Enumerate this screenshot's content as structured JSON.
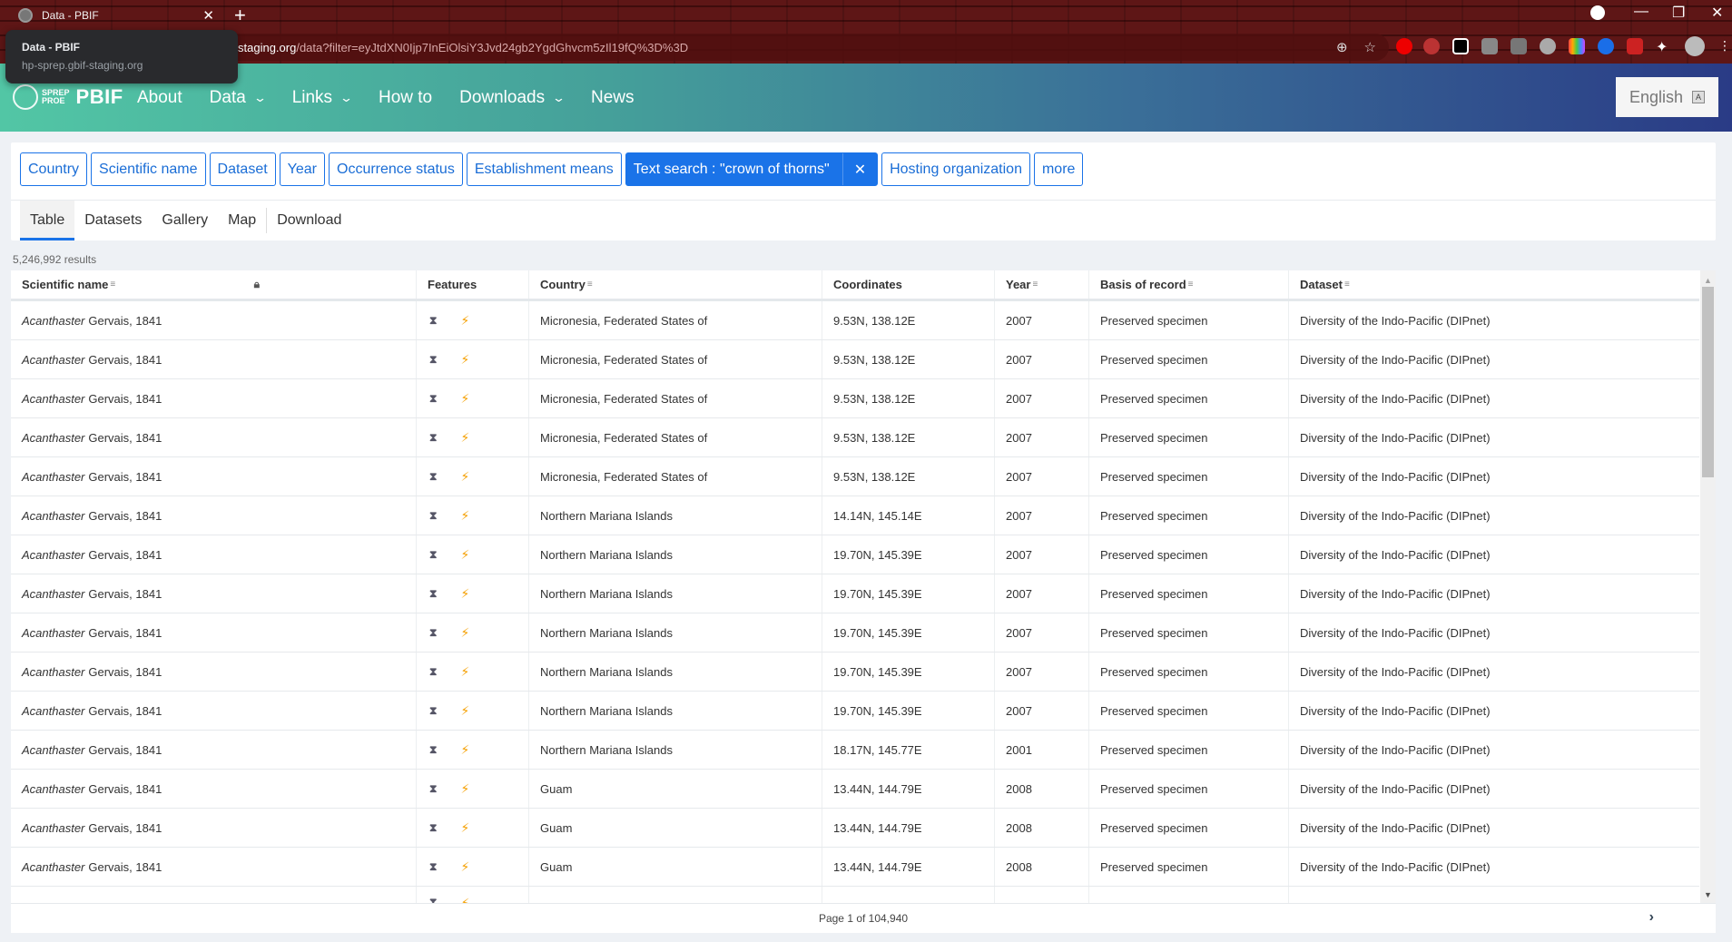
{
  "browser": {
    "tab_title": "Data - PBIF",
    "tooltip_title": "Data - PBIF",
    "tooltip_host": "hp-sprep.gbif-staging.org",
    "url_host": "staging.org",
    "url_rest": "/data?filter=eyJtdXN0Ijp7InEiOlsiY3Jvd24gb2YgdGhvcm5zIl19fQ%3D%3D"
  },
  "header": {
    "logo_text_1": "SPREP",
    "logo_text_2": "PROE",
    "logo_brand": "PBIF",
    "nav": [
      {
        "label": "About",
        "dropdown": false
      },
      {
        "label": "Data",
        "dropdown": true
      },
      {
        "label": "Links",
        "dropdown": true
      },
      {
        "label": "How to",
        "dropdown": false
      },
      {
        "label": "Downloads",
        "dropdown": true
      },
      {
        "label": "News",
        "dropdown": false
      }
    ],
    "language": "English"
  },
  "filters": [
    {
      "label": "Country"
    },
    {
      "label": "Scientific name"
    },
    {
      "label": "Dataset"
    },
    {
      "label": "Year"
    },
    {
      "label": "Occurrence status"
    },
    {
      "label": "Establishment means"
    },
    {
      "label": "Text search : \"crown of thorns\"",
      "active": true
    },
    {
      "label": "Hosting organization"
    },
    {
      "label": "more"
    }
  ],
  "view_tabs": [
    {
      "label": "Table",
      "active": true
    },
    {
      "label": "Datasets"
    },
    {
      "label": "Gallery"
    },
    {
      "label": "Map"
    },
    {
      "label": "Download"
    }
  ],
  "results_count": "5,246,992 results",
  "table": {
    "columns": [
      "Scientific name",
      "Features",
      "Country",
      "Coordinates",
      "Year",
      "Basis of record",
      "Dataset"
    ],
    "rows": [
      {
        "genus": "Acanthaster",
        "author": "Gervais, 1841",
        "country": "Micronesia, Federated States of",
        "coords": "9.53N, 138.12E",
        "year": "2007",
        "basis": "Preserved specimen",
        "dataset": "Diversity of the Indo-Pacific (DIPnet)"
      },
      {
        "genus": "Acanthaster",
        "author": "Gervais, 1841",
        "country": "Micronesia, Federated States of",
        "coords": "9.53N, 138.12E",
        "year": "2007",
        "basis": "Preserved specimen",
        "dataset": "Diversity of the Indo-Pacific (DIPnet)"
      },
      {
        "genus": "Acanthaster",
        "author": "Gervais, 1841",
        "country": "Micronesia, Federated States of",
        "coords": "9.53N, 138.12E",
        "year": "2007",
        "basis": "Preserved specimen",
        "dataset": "Diversity of the Indo-Pacific (DIPnet)"
      },
      {
        "genus": "Acanthaster",
        "author": "Gervais, 1841",
        "country": "Micronesia, Federated States of",
        "coords": "9.53N, 138.12E",
        "year": "2007",
        "basis": "Preserved specimen",
        "dataset": "Diversity of the Indo-Pacific (DIPnet)"
      },
      {
        "genus": "Acanthaster",
        "author": "Gervais, 1841",
        "country": "Micronesia, Federated States of",
        "coords": "9.53N, 138.12E",
        "year": "2007",
        "basis": "Preserved specimen",
        "dataset": "Diversity of the Indo-Pacific (DIPnet)"
      },
      {
        "genus": "Acanthaster",
        "author": "Gervais, 1841",
        "country": "Northern Mariana Islands",
        "coords": "14.14N, 145.14E",
        "year": "2007",
        "basis": "Preserved specimen",
        "dataset": "Diversity of the Indo-Pacific (DIPnet)"
      },
      {
        "genus": "Acanthaster",
        "author": "Gervais, 1841",
        "country": "Northern Mariana Islands",
        "coords": "19.70N, 145.39E",
        "year": "2007",
        "basis": "Preserved specimen",
        "dataset": "Diversity of the Indo-Pacific (DIPnet)"
      },
      {
        "genus": "Acanthaster",
        "author": "Gervais, 1841",
        "country": "Northern Mariana Islands",
        "coords": "19.70N, 145.39E",
        "year": "2007",
        "basis": "Preserved specimen",
        "dataset": "Diversity of the Indo-Pacific (DIPnet)"
      },
      {
        "genus": "Acanthaster",
        "author": "Gervais, 1841",
        "country": "Northern Mariana Islands",
        "coords": "19.70N, 145.39E",
        "year": "2007",
        "basis": "Preserved specimen",
        "dataset": "Diversity of the Indo-Pacific (DIPnet)"
      },
      {
        "genus": "Acanthaster",
        "author": "Gervais, 1841",
        "country": "Northern Mariana Islands",
        "coords": "19.70N, 145.39E",
        "year": "2007",
        "basis": "Preserved specimen",
        "dataset": "Diversity of the Indo-Pacific (DIPnet)"
      },
      {
        "genus": "Acanthaster",
        "author": "Gervais, 1841",
        "country": "Northern Mariana Islands",
        "coords": "19.70N, 145.39E",
        "year": "2007",
        "basis": "Preserved specimen",
        "dataset": "Diversity of the Indo-Pacific (DIPnet)"
      },
      {
        "genus": "Acanthaster",
        "author": "Gervais, 1841",
        "country": "Northern Mariana Islands",
        "coords": "18.17N, 145.77E",
        "year": "2001",
        "basis": "Preserved specimen",
        "dataset": "Diversity of the Indo-Pacific (DIPnet)"
      },
      {
        "genus": "Acanthaster",
        "author": "Gervais, 1841",
        "country": "Guam",
        "coords": "13.44N, 144.79E",
        "year": "2008",
        "basis": "Preserved specimen",
        "dataset": "Diversity of the Indo-Pacific (DIPnet)"
      },
      {
        "genus": "Acanthaster",
        "author": "Gervais, 1841",
        "country": "Guam",
        "coords": "13.44N, 144.79E",
        "year": "2008",
        "basis": "Preserved specimen",
        "dataset": "Diversity of the Indo-Pacific (DIPnet)"
      },
      {
        "genus": "Acanthaster",
        "author": "Gervais, 1841",
        "country": "Guam",
        "coords": "13.44N, 144.79E",
        "year": "2008",
        "basis": "Preserved specimen",
        "dataset": "Diversity of the Indo-Pacific (DIPnet)"
      },
      {
        "genus": "",
        "author": "",
        "country": "",
        "coords": "",
        "year": "",
        "basis": "",
        "dataset": ""
      }
    ]
  },
  "pager": {
    "text": "Page 1 of 104,940"
  },
  "icons": {
    "sort": "≡",
    "lock": "🔒",
    "dna": "⧗",
    "bolt": "⚡",
    "close": "✕",
    "next": "›",
    "chevron": "⌄"
  },
  "colors": {
    "accent": "#1a73e8",
    "bolt": "#f5a000"
  }
}
